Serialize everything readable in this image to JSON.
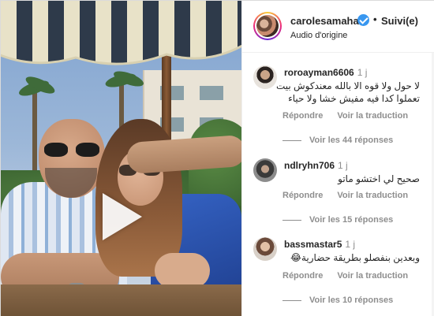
{
  "post": {
    "username": "carolesamaha",
    "separator": "•",
    "follow_status": "Suivi(e)",
    "audio": "Audio d'origine"
  },
  "comments": [
    {
      "username": "roroayman6606",
      "time": "1 j",
      "lines": [
        "لا حول ولا قوه الا بالله معندكوش بيت",
        "تعملوا كدا فيه مفيش خشا ولا حياء"
      ],
      "reply_label": "Répondre",
      "translate_label": "Voir la traduction",
      "replies_label": "Voir les 44 réponses"
    },
    {
      "username": "ndlryhn706",
      "time": "1 j",
      "lines": [
        "صحيح لي اختشو ماتو"
      ],
      "reply_label": "Répondre",
      "translate_label": "Voir la traduction",
      "replies_label": "Voir les 15 réponses"
    },
    {
      "username": "bassmastar5",
      "time": "1 j",
      "lines": [
        "وبعدين بنفصلو بطريقة حضارية😂"
      ],
      "reply_label": "Répondre",
      "translate_label": "Voir la traduction",
      "replies_label": "Voir les 10 réponses"
    }
  ],
  "icons": {
    "verified": "verified-badge-icon",
    "play": "play-icon"
  },
  "colors": {
    "verified_blue": "#3897f0",
    "muted_text": "#8e8e8e",
    "text": "#262626"
  }
}
